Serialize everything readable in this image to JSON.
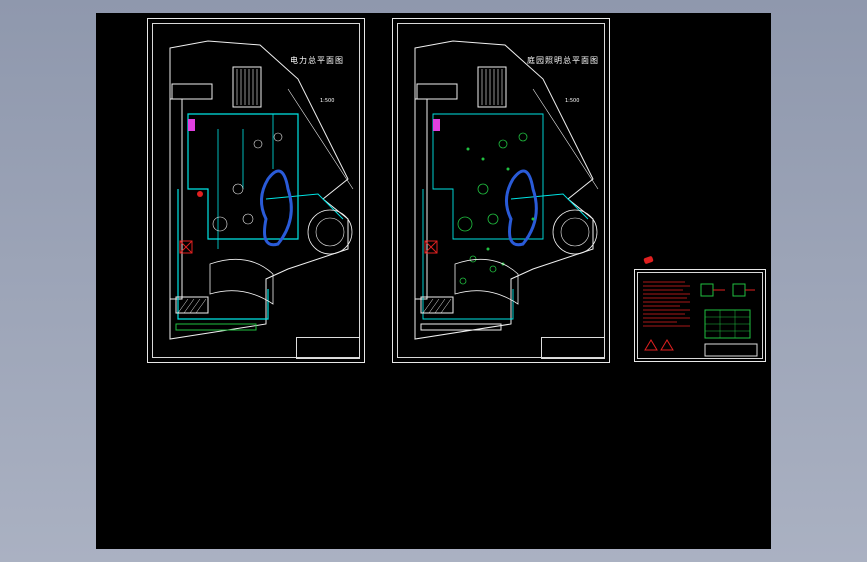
{
  "sheets": [
    {
      "title": "电力总平面图",
      "scale": "1:500"
    },
    {
      "title": "庭园照明总平面图",
      "scale": "1:500"
    }
  ],
  "colors": {
    "background": "#000000",
    "frame": "#e8e8e8",
    "cyan": "#00e5e5",
    "white_lines": "#f0f0f0",
    "blue_pool": "#2a5bd8",
    "magenta": "#e040e0",
    "red": "#e02020",
    "green": "#20c040",
    "yellow": "#e0e000"
  }
}
